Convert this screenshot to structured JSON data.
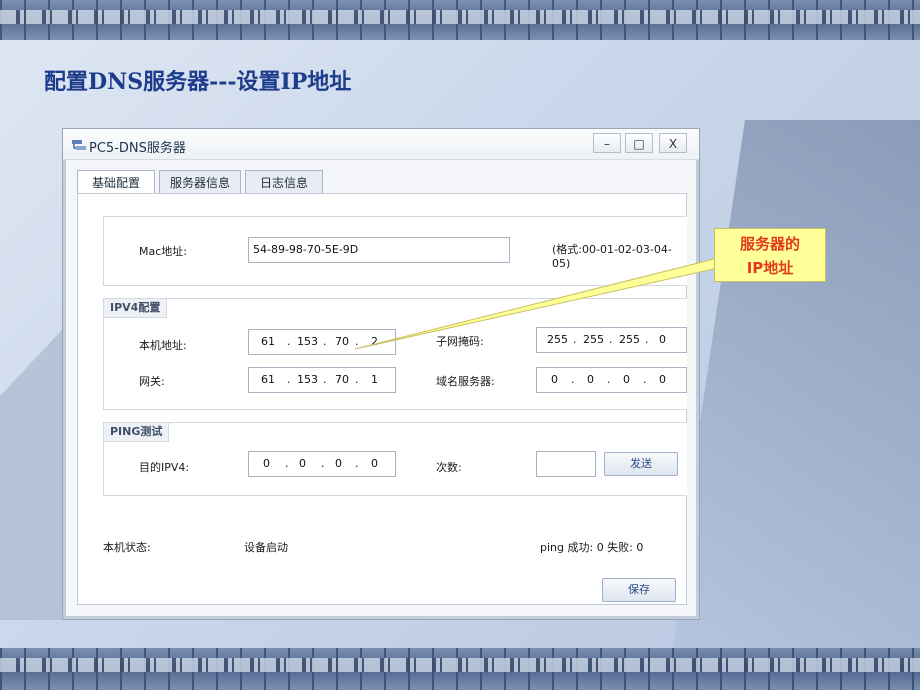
{
  "slide": {
    "title": "配置DNS服务器---设置IP地址"
  },
  "window": {
    "title": "PC5-DNS服务器",
    "minimize": "–",
    "maximize": "□",
    "close": "X"
  },
  "tabs": [
    {
      "label": "基础配置",
      "active": true
    },
    {
      "label": "服务器信息",
      "active": false
    },
    {
      "label": "日志信息",
      "active": false
    }
  ],
  "mac": {
    "label": "Mac地址:",
    "value": "54-89-98-70-5E-9D",
    "format": "(格式:00-01-02-03-04-05)"
  },
  "ipv4": {
    "section_label": "IPV4配置",
    "ip_label": "本机地址:",
    "ip": [
      "61",
      "153",
      "70",
      "2"
    ],
    "mask_label": "子网掩码:",
    "mask": [
      "255",
      "255",
      "255",
      "0"
    ],
    "gateway_label": "网关:",
    "gateway": [
      "61",
      "153",
      "70",
      "1"
    ],
    "dns_label": "域名服务器:",
    "dns": [
      "0",
      "0",
      "0",
      "0"
    ]
  },
  "ping": {
    "section_label": "PING测试",
    "target_label": "目的IPV4:",
    "target": [
      "0",
      "0",
      "0",
      "0"
    ],
    "count_label": "次数:",
    "count_value": "",
    "send_label": "发送"
  },
  "status": {
    "label": "本机状态:",
    "value": "设备启动",
    "ping_result": "ping 成功: 0 失败: 0"
  },
  "save_label": "保存",
  "callout": {
    "line1": "服务器的",
    "line2": "IP地址"
  },
  "colors": {
    "title": "#1e3c8c",
    "callout_bg": "#ffff99",
    "callout_text": "#e23a1c"
  }
}
